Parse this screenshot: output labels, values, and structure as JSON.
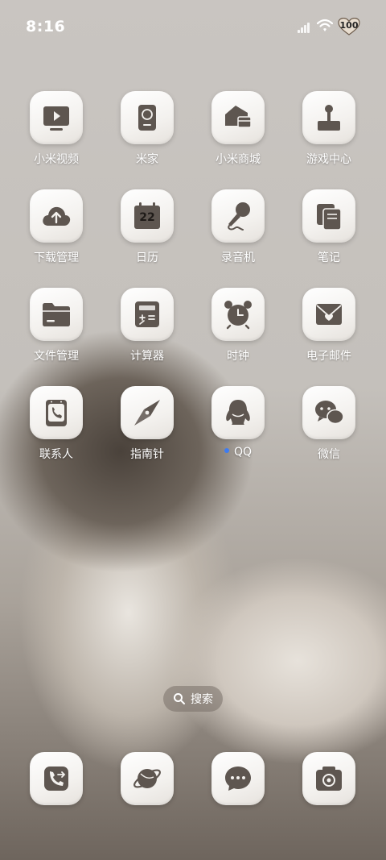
{
  "status_bar": {
    "time": "8:16",
    "battery_level": "100"
  },
  "apps": [
    {
      "label": "小米视频",
      "icon": "video-player-icon"
    },
    {
      "label": "米家",
      "icon": "mijia-device-icon"
    },
    {
      "label": "小米商城",
      "icon": "shopping-mall-icon"
    },
    {
      "label": "游戏中心",
      "icon": "joystick-icon"
    },
    {
      "label": "下载管理",
      "icon": "cloud-upload-icon"
    },
    {
      "label": "日历",
      "icon": "calendar-icon",
      "date": "22"
    },
    {
      "label": "录音机",
      "icon": "microphone-icon"
    },
    {
      "label": "笔记",
      "icon": "notes-icon"
    },
    {
      "label": "文件管理",
      "icon": "folder-icon"
    },
    {
      "label": "计算器",
      "icon": "calculator-icon"
    },
    {
      "label": "时钟",
      "icon": "alarm-clock-icon"
    },
    {
      "label": "电子邮件",
      "icon": "mail-icon"
    },
    {
      "label": "联系人",
      "icon": "contact-phone-icon"
    },
    {
      "label": "指南针",
      "icon": "compass-icon"
    },
    {
      "label": "QQ",
      "icon": "qq-penguin-icon",
      "new_badge": true
    },
    {
      "label": "微信",
      "icon": "wechat-chat-icon"
    }
  ],
  "search": {
    "label": "搜索",
    "icon": "search-icon"
  },
  "dock": [
    {
      "icon": "phone-icon"
    },
    {
      "icon": "browser-planet-icon"
    },
    {
      "icon": "messages-icon"
    },
    {
      "icon": "camera-icon"
    }
  ],
  "colors": {
    "icon_glyph": "#5e5650",
    "tile_bg": "#f3f1ee",
    "badge_dot": "#3d7cf2"
  }
}
